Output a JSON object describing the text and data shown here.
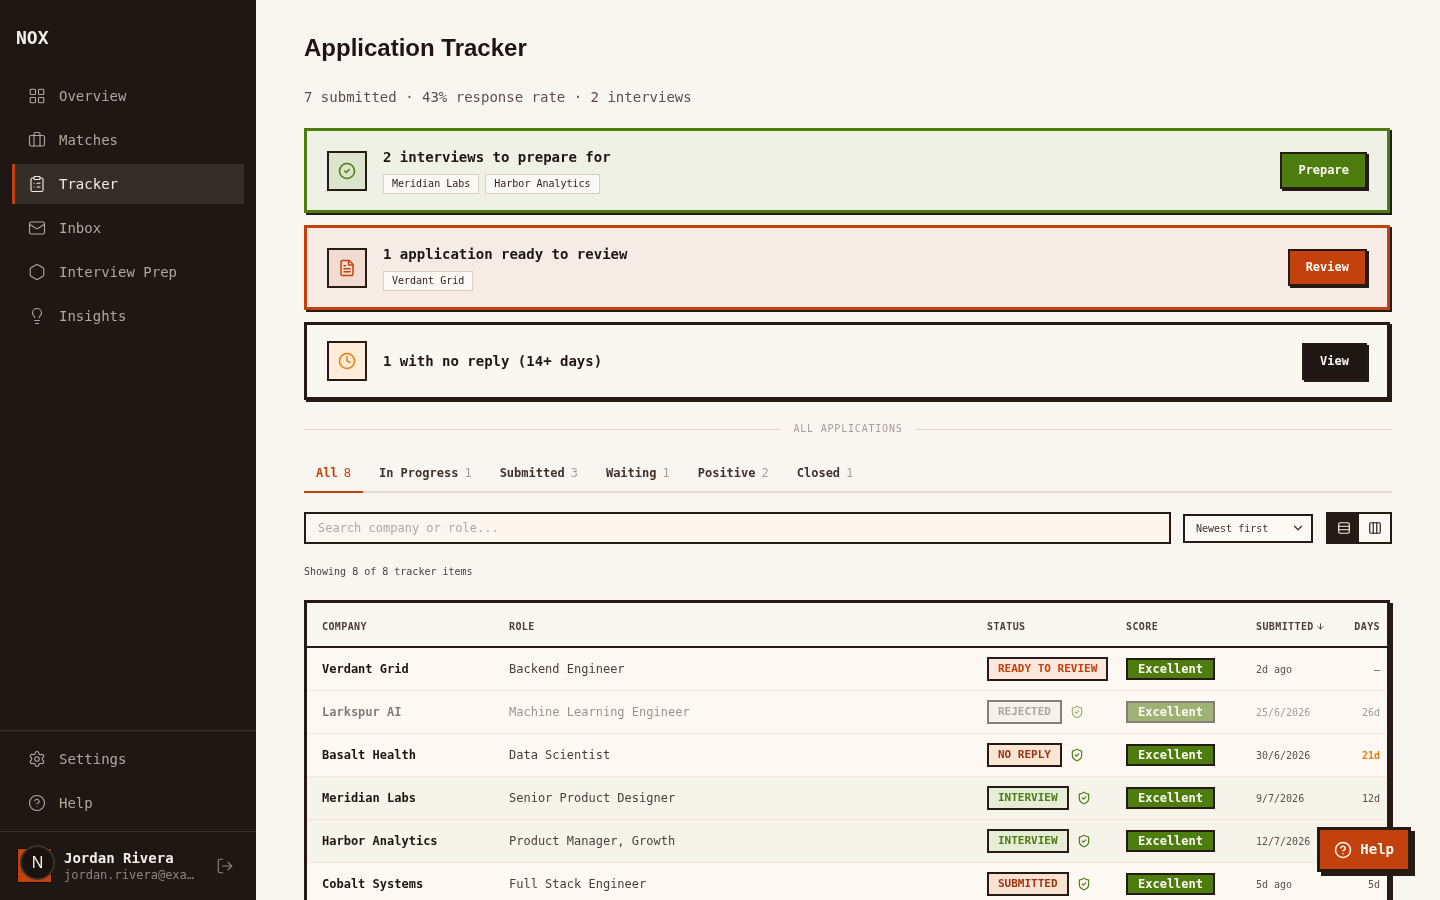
{
  "sidebar": {
    "logo": "NOX",
    "nav": [
      {
        "label": "Overview",
        "selected": false
      },
      {
        "label": "Matches",
        "selected": false
      },
      {
        "label": "Tracker",
        "selected": true
      },
      {
        "label": "Inbox",
        "selected": false
      },
      {
        "label": "Interview Prep",
        "selected": false
      },
      {
        "label": "Insights",
        "selected": false
      }
    ],
    "footer_nav": [
      {
        "label": "Settings",
        "selected": false
      },
      {
        "label": "Help",
        "selected": false
      }
    ],
    "user": {
      "avatar_letter": "N",
      "name": "Jordan Rivera",
      "email": "jordan.rivera@exa…"
    }
  },
  "header": {
    "title": "Application Tracker",
    "summary": "7 submitted · 43% response rate · 2 interviews"
  },
  "alerts": [
    {
      "kind": "interview",
      "title": "2 interviews to prepare for",
      "tags": [
        "Meridian Labs",
        "Harbor Analytics"
      ],
      "button": "Prepare"
    },
    {
      "kind": "review",
      "title": "1 application ready to review",
      "tags": [
        "Verdant Grid"
      ],
      "button": "Review"
    },
    {
      "kind": "stale",
      "title": "1 with no reply (14+ days)",
      "button": "View"
    }
  ],
  "section_label": "ALL APPLICATIONS",
  "tabs": [
    {
      "label": "All",
      "count": "8",
      "selected": true
    },
    {
      "label": "In Progress",
      "count": "1",
      "selected": false
    },
    {
      "label": "Submitted",
      "count": "3",
      "selected": false
    },
    {
      "label": "Waiting",
      "count": "1",
      "selected": false
    },
    {
      "label": "Positive",
      "count": "2",
      "selected": false
    },
    {
      "label": "Closed",
      "count": "1",
      "selected": false
    }
  ],
  "search": {
    "placeholder": "Search company or role..."
  },
  "sort_select": {
    "value": "Newest first"
  },
  "view_toggle": [
    {
      "selected": true
    },
    {
      "selected": false
    }
  ],
  "result_count": "Showing 8 of 8 tracker items",
  "table": {
    "columns": [
      {
        "label": "COMPANY",
        "sorted": false
      },
      {
        "label": "ROLE",
        "sorted": false
      },
      {
        "label": "STATUS",
        "sorted": false
      },
      {
        "label": "SCORE",
        "sorted": false
      },
      {
        "label": "SUBMITTED",
        "sorted": true
      },
      {
        "label": "DAYS",
        "sorted": false
      }
    ],
    "rows": [
      {
        "company": "Verdant Grid",
        "role": "Backend Engineer",
        "status": {
          "kind": "ready",
          "label": "READY TO REVIEW"
        },
        "verified": false,
        "score": "Excellent",
        "submitted": "2d ago",
        "days": "—",
        "overdue": false,
        "dimmed": false
      },
      {
        "company": "Larkspur AI",
        "role": "Machine Learning Engineer",
        "status": {
          "kind": "rejected",
          "label": "REJECTED"
        },
        "verified": true,
        "score": "Excellent",
        "submitted": "25/6/2026",
        "days": "26d",
        "overdue": false,
        "dimmed": true
      },
      {
        "company": "Basalt Health",
        "role": "Data Scientist",
        "status": {
          "kind": "no_reply",
          "label": "NO REPLY"
        },
        "verified": true,
        "score": "Excellent",
        "submitted": "30/6/2026",
        "days": "21d",
        "overdue": true,
        "dimmed": false
      },
      {
        "company": "Meridian Labs",
        "role": "Senior Product Designer",
        "status": {
          "kind": "interview",
          "label": "INTERVIEW"
        },
        "verified": true,
        "score": "Excellent",
        "submitted": "9/7/2026",
        "days": "12d",
        "overdue": false,
        "dimmed": false
      },
      {
        "company": "Harbor Analytics",
        "role": "Product Manager, Growth",
        "status": {
          "kind": "interview",
          "label": "INTERVIEW"
        },
        "verified": true,
        "score": "Excellent",
        "submitted": "12/7/2026",
        "dimmed": false
      },
      {
        "company": "Cobalt Systems",
        "role": "Full Stack Engineer",
        "status": {
          "kind": "submitted",
          "label": "SUBMITTED"
        },
        "verified": true,
        "score": "Excellent",
        "submitted": "5d ago",
        "days": "5d",
        "overdue": false,
        "dimmed": false
      }
    ]
  },
  "help_button": {
    "label": "Help"
  }
}
